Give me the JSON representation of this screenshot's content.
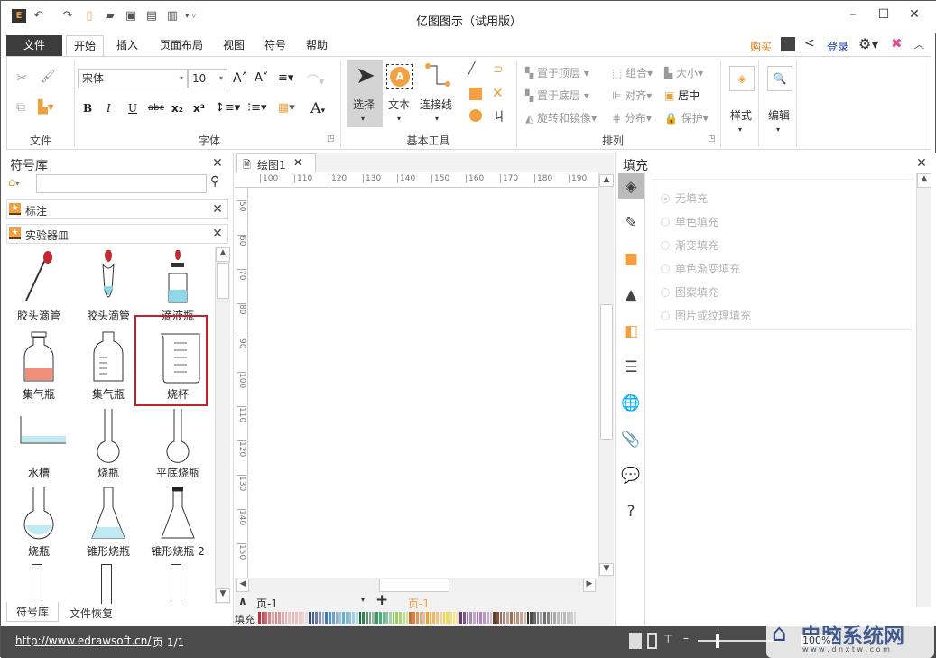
{
  "app": {
    "title": "亿图图示（试用版）"
  },
  "title_icons": [
    "app-logo-icon",
    "undo-icon",
    "redo-icon",
    "new-icon",
    "open-icon",
    "save-icon",
    "print-icon",
    "export-icon",
    "customize-icon"
  ],
  "menu": {
    "tabs": [
      "文件",
      "开始",
      "插入",
      "页面布局",
      "视图",
      "符号",
      "帮助"
    ],
    "active": "开始",
    "buy": "购买",
    "login": "登录"
  },
  "ribbon": {
    "groups": {
      "file": "文件",
      "font": "字体",
      "basic": "基本工具",
      "arrange": "排列"
    },
    "font_name": "宋体",
    "font_size": "10",
    "format_buttons": [
      "B",
      "I",
      "U",
      "abc",
      "x₂",
      "x²"
    ],
    "select": "选择",
    "text": "文本",
    "connector": "连接线",
    "arrange": {
      "bring_front": "置于顶层",
      "send_back": "置于底层",
      "rotate": "旋转和镜像",
      "group": "组合",
      "align": "对齐",
      "distribute": "分布",
      "size": "大小",
      "center": "居中",
      "protect": "保护"
    },
    "style": "样式",
    "edit": "编辑"
  },
  "library": {
    "title": "符号库",
    "search_value": "",
    "sections": [
      "标注",
      "实验器皿"
    ],
    "symbols": [
      "胶头滴管",
      "胶头滴管",
      "滴液瓶",
      "集气瓶",
      "集气瓶",
      "烧杯",
      "水槽",
      "烧瓶",
      "平底烧瓶",
      "烧瓶",
      "锥形烧瓶",
      "锥形烧瓶 2"
    ],
    "selected": "烧杯",
    "bottom_tabs": [
      "符号库",
      "文件恢复"
    ]
  },
  "canvas": {
    "doc_tab": "绘图1",
    "h_ruler": [
      "100",
      "110",
      "120",
      "130",
      "140",
      "150",
      "160",
      "170",
      "180",
      "190"
    ],
    "v_ruler": [
      "50",
      "60",
      "70",
      "80",
      "90",
      "100",
      "110",
      "120",
      "130",
      "140",
      "150"
    ],
    "page_select": "页-1",
    "page_tab": "页-1",
    "fill_label": "填充"
  },
  "palette": [
    "#c0303a",
    "#d88a8a",
    "#e8b8b8",
    "#304a80",
    "#3a7ab8",
    "#60b0d8",
    "#1a6a3a",
    "#30a060",
    "#90c848",
    "#d87020",
    "#e8a030",
    "#f0d840",
    "#6a3a78",
    "#a070b0",
    "#6a3a20",
    "#a07050",
    "#303030",
    "#707070",
    "#b0b0b0"
  ],
  "fill_panel": {
    "title": "填充",
    "options": [
      "无填充",
      "单色填充",
      "渐变填充",
      "单色渐变填充",
      "图案填充",
      "图片或纹理填充"
    ],
    "selected": "无填充",
    "side_icons": [
      "fill-icon",
      "line-icon",
      "shadow-color-icon",
      "image-icon",
      "layer-icon",
      "data-icon",
      "hyperlink-icon",
      "attachment-icon",
      "comment-icon",
      "help-icon"
    ]
  },
  "status": {
    "url": "http://www.edrawsoft.cn/",
    "page": "页 1/1",
    "zoom": "100%"
  },
  "watermark": {
    "text": "电脑系统网",
    "sub": "w w w . d n x t w . c o m"
  },
  "colors": {
    "accent": "#f5a040",
    "file_tab": "#3c3c3c",
    "status_bar": "#4b4b4b",
    "selection": "#c8202a",
    "link": "#1a3aa0"
  }
}
